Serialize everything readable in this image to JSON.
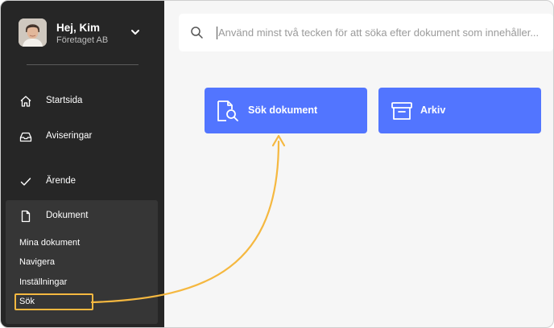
{
  "user": {
    "greeting": "Hej, Kim",
    "company": "Företaget AB"
  },
  "sidebar": {
    "items": [
      {
        "label": "Startsida",
        "icon": "home-icon"
      },
      {
        "label": "Aviseringar",
        "icon": "inbox-icon"
      },
      {
        "label": "Ärende",
        "icon": "check-icon"
      },
      {
        "label": "Dokument",
        "icon": "document-icon"
      }
    ],
    "document_subitems": [
      {
        "label": "Mina dokument"
      },
      {
        "label": "Navigera"
      },
      {
        "label": "Inställningar"
      },
      {
        "label": "Sök",
        "highlighted": true
      }
    ]
  },
  "search": {
    "placeholder": "Använd minst två tecken för att söka efter dokument som innehåller..."
  },
  "actions": [
    {
      "label": "Sök dokument",
      "icon": "search-document-icon"
    },
    {
      "label": "Arkiv",
      "icon": "archive-icon"
    }
  ],
  "colors": {
    "sidebar_bg": "#262626",
    "sidebar_group_bg": "#363636",
    "accent": "#5275ff",
    "highlight": "#f5b840",
    "main_bg": "#f6f6f6"
  }
}
